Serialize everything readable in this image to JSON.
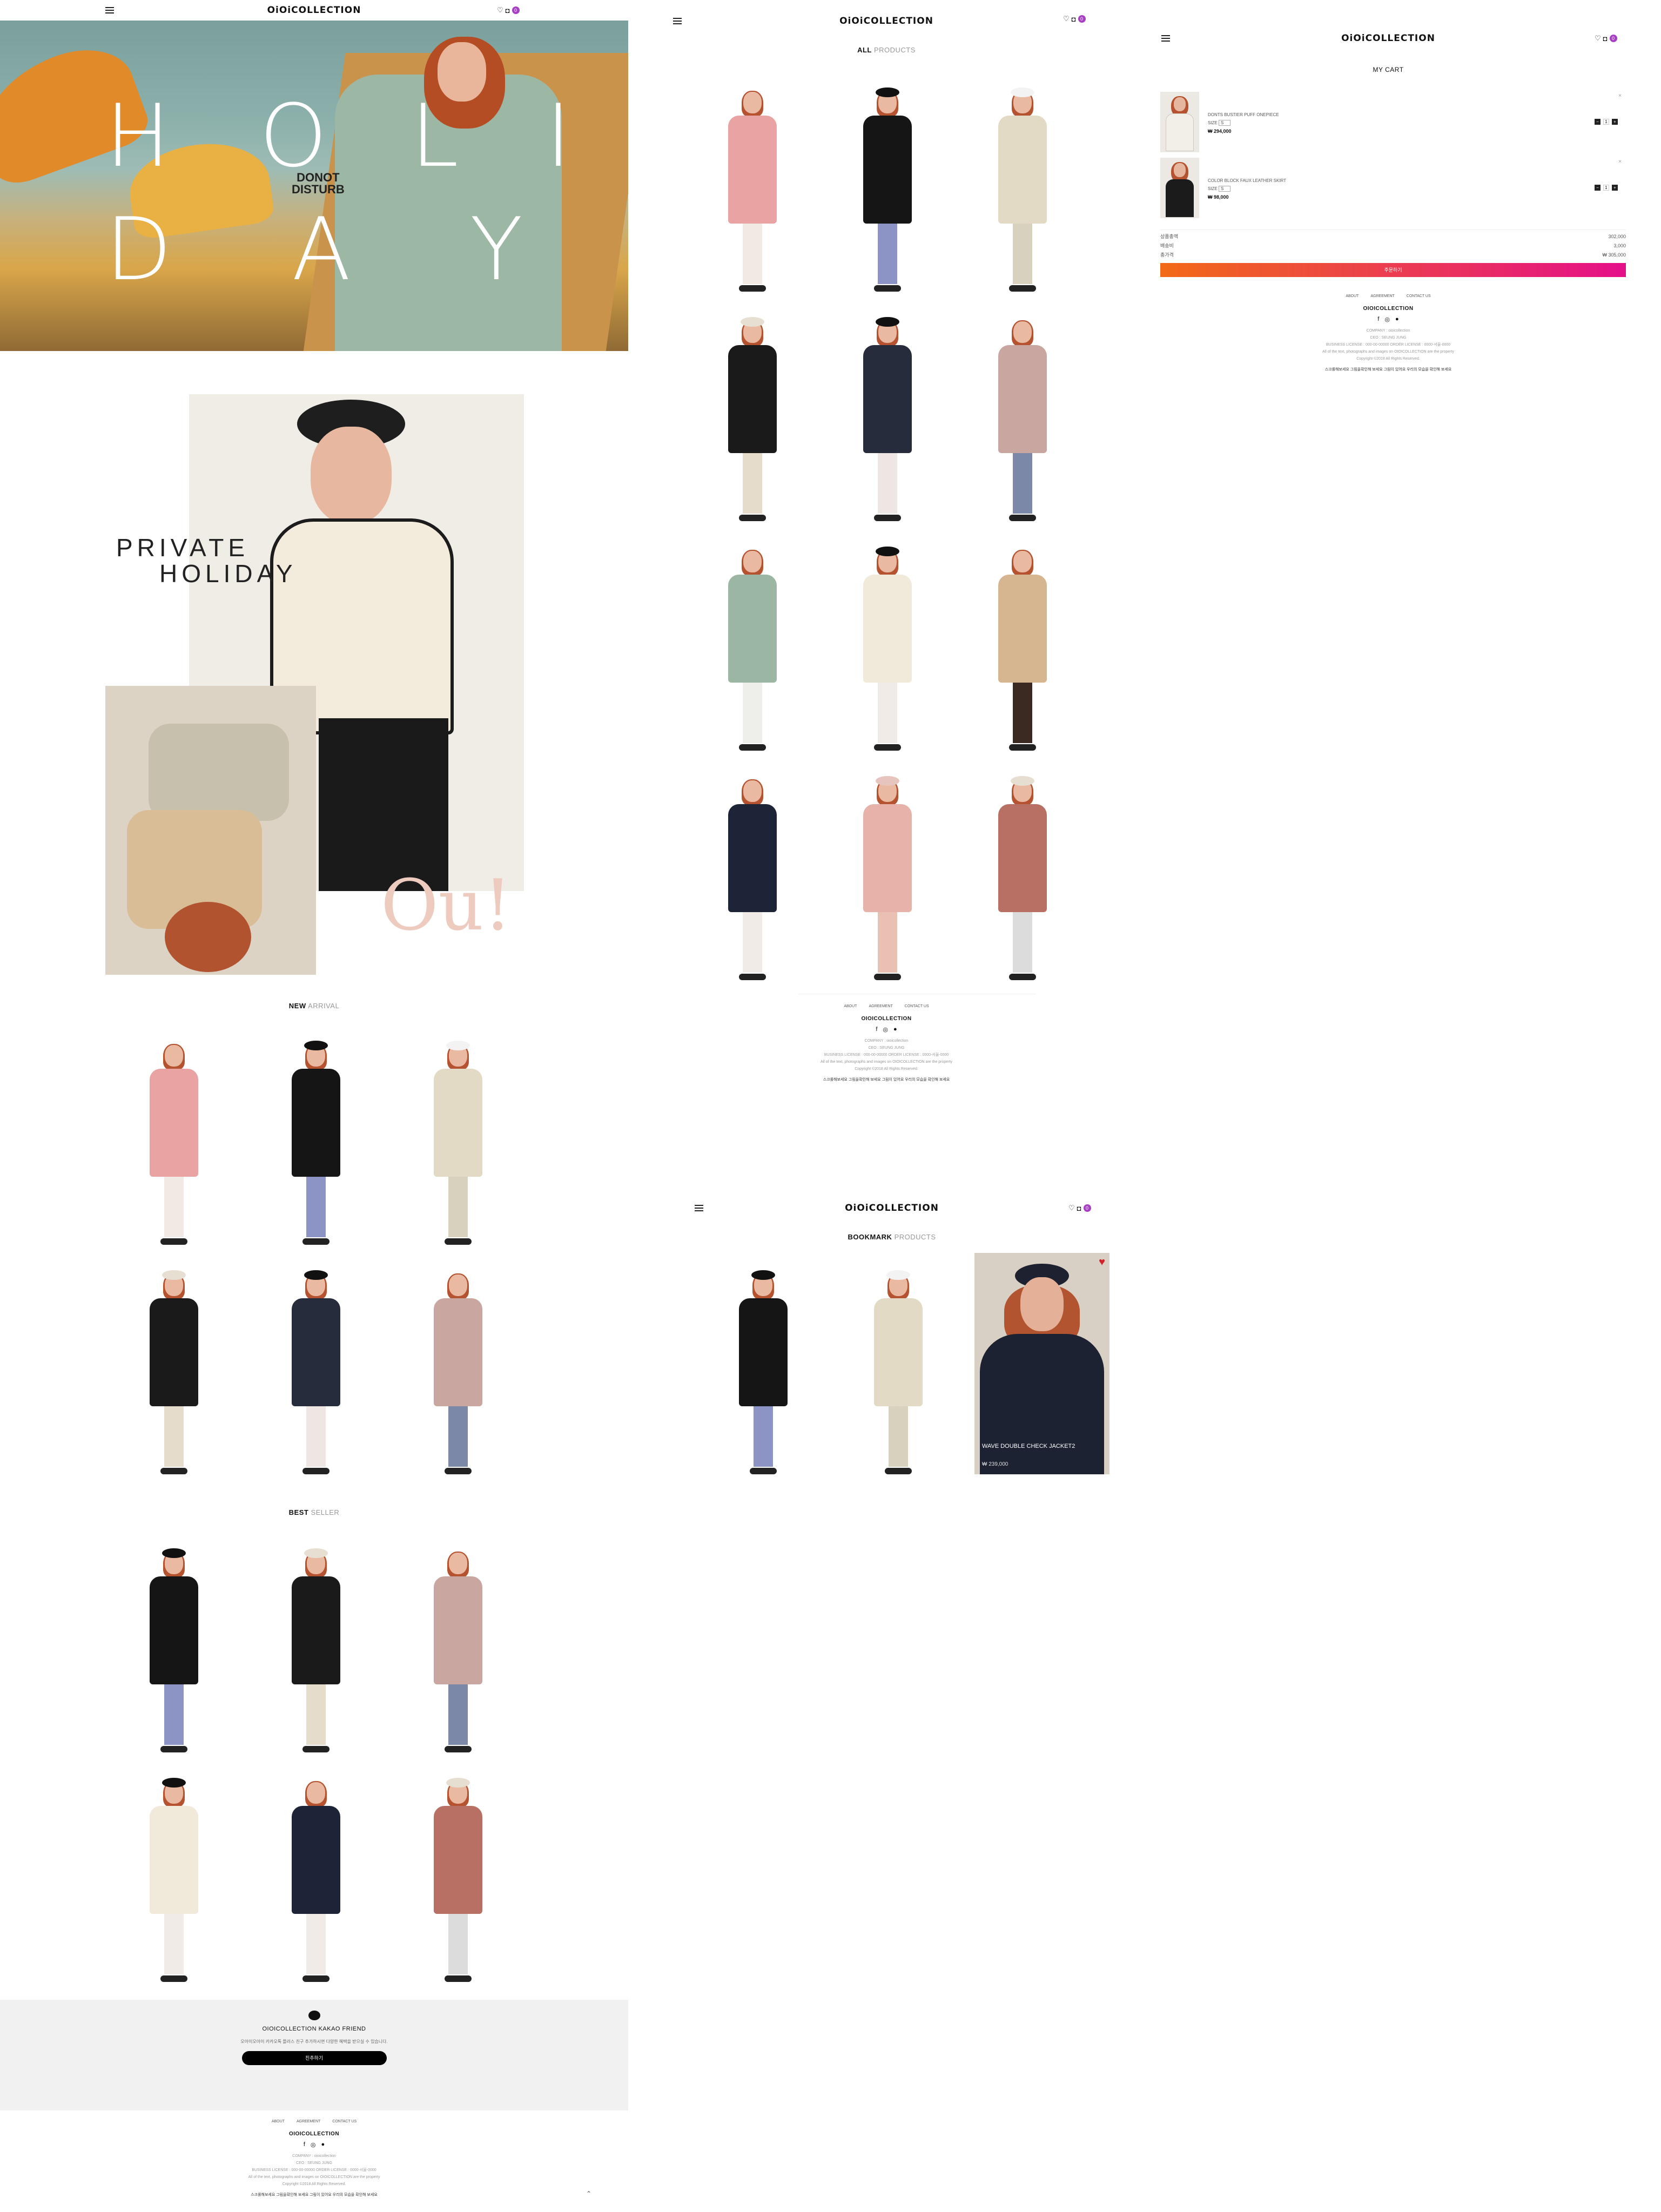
{
  "brand": {
    "logo": "OiOiCOLLECTION",
    "cart_count": "0",
    "accent": "#a63fc4"
  },
  "icons": {
    "menu": "hamburger-icon",
    "wish": "heart-icon",
    "cart": "bag-icon"
  },
  "home": {
    "hero": {
      "letters": [
        "H",
        "O",
        "L",
        "I",
        "D",
        "A",
        "Y"
      ],
      "tag_line1": "DONOT",
      "tag_line2": "DISTURB"
    },
    "collage": {
      "title_line1": "PRIVATE",
      "title_line2": "HOLIDAY",
      "script": "Ou!"
    },
    "new_arrival": {
      "bold": "NEW",
      "light": "ARRIVAL"
    },
    "best_seller": {
      "bold": "BEST",
      "light": "SELLER"
    },
    "kakao": {
      "title": "OIOICOLLECTION KAKAO FRIEND",
      "desc": "오아이오아이 카카오톡 플러스 친구 추가하시면 다양한 혜택을 받으실 수 있습니다.",
      "button": "친추하기"
    }
  },
  "footer": {
    "links": [
      "ABOUT",
      "AGREEMENT",
      "CONTACT US"
    ],
    "logo": "OIOICOLLECTION",
    "social": [
      "f",
      "◎",
      "●"
    ],
    "info_lines": [
      "COMPANY : oioicollection",
      "CEO : SEUNG JUNG",
      "BUSINESS LICENSE : 000-00-00000   ORDER LICENSE : 0000-서울-0000",
      "All of the text, photographs and images on OIOICOLLECTION are the property",
      "Copyright ©2018 All Rights Reserved."
    ],
    "bottom": "스크롤해보세요 그림을확인해 보세요 그림이 있어요 우리의 모습을 확인해 보세요"
  },
  "all_products": {
    "bold": "ALL",
    "light": "PRODUCTS"
  },
  "bookmark": {
    "bold": "BOOKMARK",
    "light": "PRODUCTS",
    "featured": {
      "name": "WAVE DOUBLE CHECK JACKET2",
      "price": "₩ 239,000"
    }
  },
  "cart": {
    "title": "MY CART",
    "items": [
      {
        "name": "DONTS BUSTIER PUFF ONEPIECE",
        "size_label": "SIZE",
        "size": "S",
        "price": "₩ 294,000",
        "qty": "1"
      },
      {
        "name": "COLOR BLOCK FAUX LEATHER SKIRT",
        "size_label": "SIZE",
        "size": "S",
        "price": "₩ 98,000",
        "qty": "1"
      }
    ],
    "summary": [
      {
        "label": "상품총액",
        "value": "302,000"
      },
      {
        "label": "배송비",
        "value": "3,000"
      },
      {
        "label": "총가격",
        "value": "₩ 305,000"
      }
    ],
    "checkout": "주문하기"
  }
}
